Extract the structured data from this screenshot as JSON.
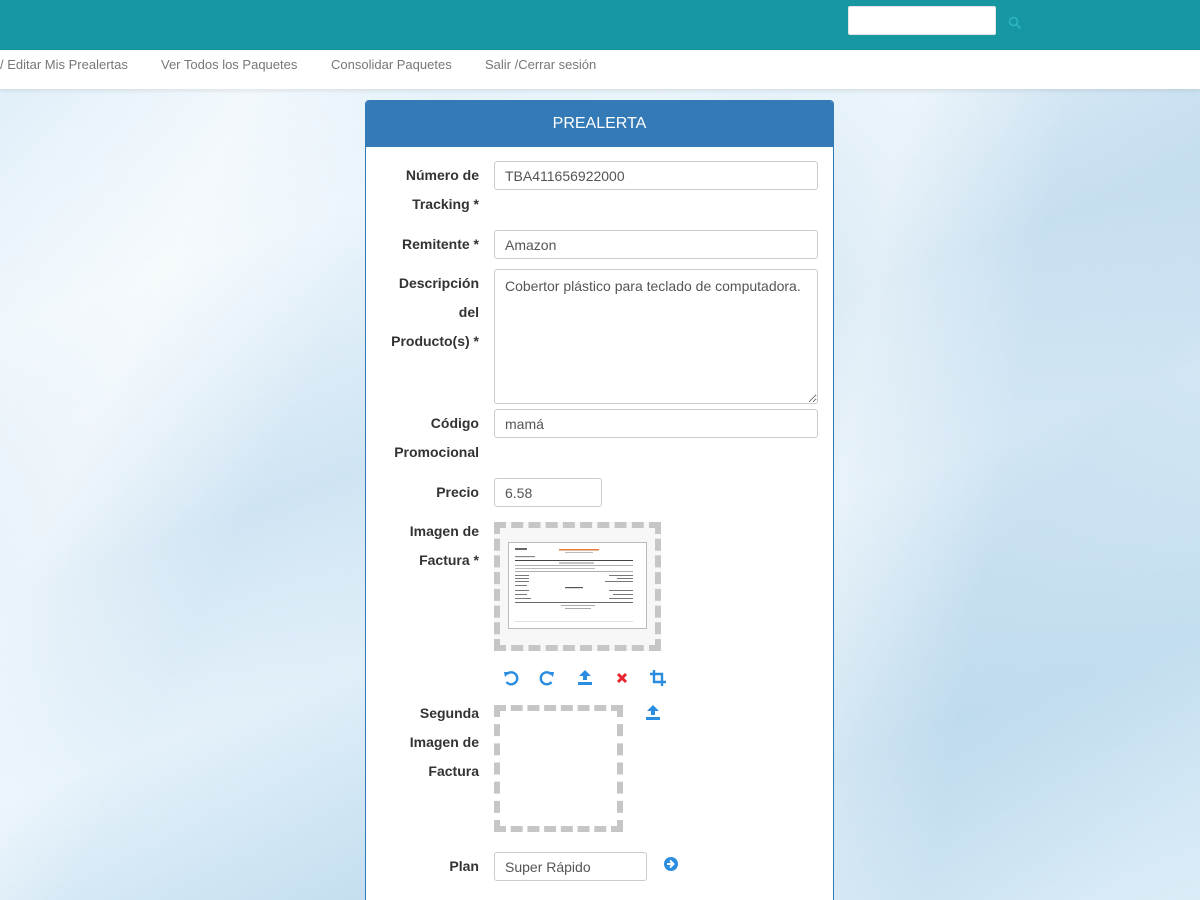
{
  "topbar": {
    "search_placeholder": "",
    "search_value": "",
    "search_icon": "search-icon"
  },
  "nav": {
    "items": [
      {
        "label": "/ Editar Mis Prealertas"
      },
      {
        "label": "Ver Todos los Paquetes"
      },
      {
        "label": "Consolidar Paquetes"
      },
      {
        "label": "Salir /Cerrar sesión"
      }
    ]
  },
  "form": {
    "title": "PREALERTA",
    "tracking": {
      "label_line1": "Número de",
      "label_line2": "Tracking *",
      "value": "TBA411656922000"
    },
    "sender": {
      "label": "Remitente *",
      "value": "Amazon"
    },
    "description": {
      "label_line1": "Descripción",
      "label_line2": "del",
      "label_line3": "Producto(s) *",
      "value": "Cobertor plástico para teclado de computadora."
    },
    "promo": {
      "label_line1": "Código",
      "label_line2": "Promocional",
      "value": "mamá"
    },
    "price": {
      "label": "Precio",
      "value": "6.58"
    },
    "invoice_image": {
      "label_line1": "Imagen de",
      "label_line2": "Factura *"
    },
    "second_invoice_image": {
      "label_line1": "Segunda",
      "label_line2": "Imagen de",
      "label_line3": "Factura"
    },
    "plan": {
      "label": "Plan",
      "value": "Super Rápido"
    }
  },
  "icons": {
    "rotate_left": "rotate-left-icon",
    "rotate_right": "rotate-right-icon",
    "upload": "upload-icon",
    "remove": "remove-icon",
    "crop": "crop-icon",
    "arrow": "arrow-circle-right-icon"
  },
  "colors": {
    "topbar": "#1797a2",
    "panel_header": "#337ab7",
    "icon_blue": "#2a8de0",
    "icon_red": "#e8252e"
  }
}
